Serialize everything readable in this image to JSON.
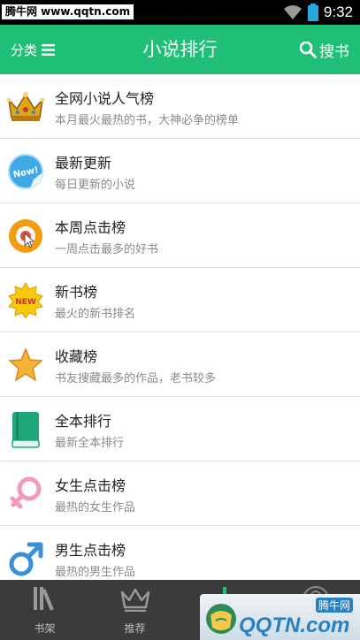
{
  "status_bar": {
    "watermark": "腾牛网 www.qqtn.com",
    "time": "9:32"
  },
  "header": {
    "category_label": "分类",
    "title": "小说排行",
    "search_label": "搜书",
    "color": "#1fbf77"
  },
  "rankings": [
    {
      "title": "全网小说人气榜",
      "subtitle": "本月最火最热的书，大神必争的榜单",
      "icon": "crown-icon"
    },
    {
      "title": "最新更新",
      "subtitle": "每日更新的小说",
      "icon": "new-badge-icon"
    },
    {
      "title": "本周点击榜",
      "subtitle": "一周点击最多的好书",
      "icon": "cursor-target-icon"
    },
    {
      "title": "新书榜",
      "subtitle": "最火的新书排名",
      "icon": "new-star-icon",
      "badge": "NEW"
    },
    {
      "title": "收藏榜",
      "subtitle": "书友搜藏最多的作品，老书较多",
      "icon": "star-icon"
    },
    {
      "title": "全本排行",
      "subtitle": "最新全本排行",
      "icon": "book-icon"
    },
    {
      "title": "女生点击榜",
      "subtitle": "最热的女生作品",
      "icon": "female-icon"
    },
    {
      "title": "男生点击榜",
      "subtitle": "最热的男生作品",
      "icon": "male-icon"
    }
  ],
  "new_badge_text": "Now!",
  "bottom_nav": {
    "tabs": [
      {
        "label": "书架",
        "icon": "bookshelf-icon"
      },
      {
        "label": "推荐",
        "icon": "crown-outline-icon"
      },
      {
        "label": "",
        "icon": "ranking-bars-icon"
      },
      {
        "label": "",
        "icon": "profile-icon"
      }
    ]
  },
  "logo_watermark": {
    "text": "QQTN.com",
    "small": "腾牛网"
  }
}
